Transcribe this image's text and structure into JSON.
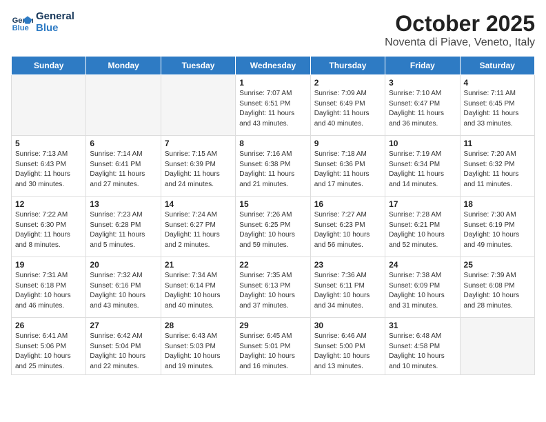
{
  "header": {
    "logo_line1": "General",
    "logo_line2": "Blue",
    "title": "October 2025",
    "subtitle": "Noventa di Piave, Veneto, Italy"
  },
  "weekdays": [
    "Sunday",
    "Monday",
    "Tuesday",
    "Wednesday",
    "Thursday",
    "Friday",
    "Saturday"
  ],
  "weeks": [
    [
      {
        "day": null
      },
      {
        "day": null
      },
      {
        "day": null
      },
      {
        "day": "1",
        "sunrise": "7:07 AM",
        "sunset": "6:51 PM",
        "daylight": "11 hours and 43 minutes."
      },
      {
        "day": "2",
        "sunrise": "7:09 AM",
        "sunset": "6:49 PM",
        "daylight": "11 hours and 40 minutes."
      },
      {
        "day": "3",
        "sunrise": "7:10 AM",
        "sunset": "6:47 PM",
        "daylight": "11 hours and 36 minutes."
      },
      {
        "day": "4",
        "sunrise": "7:11 AM",
        "sunset": "6:45 PM",
        "daylight": "11 hours and 33 minutes."
      }
    ],
    [
      {
        "day": "5",
        "sunrise": "7:13 AM",
        "sunset": "6:43 PM",
        "daylight": "11 hours and 30 minutes."
      },
      {
        "day": "6",
        "sunrise": "7:14 AM",
        "sunset": "6:41 PM",
        "daylight": "11 hours and 27 minutes."
      },
      {
        "day": "7",
        "sunrise": "7:15 AM",
        "sunset": "6:39 PM",
        "daylight": "11 hours and 24 minutes."
      },
      {
        "day": "8",
        "sunrise": "7:16 AM",
        "sunset": "6:38 PM",
        "daylight": "11 hours and 21 minutes."
      },
      {
        "day": "9",
        "sunrise": "7:18 AM",
        "sunset": "6:36 PM",
        "daylight": "11 hours and 17 minutes."
      },
      {
        "day": "10",
        "sunrise": "7:19 AM",
        "sunset": "6:34 PM",
        "daylight": "11 hours and 14 minutes."
      },
      {
        "day": "11",
        "sunrise": "7:20 AM",
        "sunset": "6:32 PM",
        "daylight": "11 hours and 11 minutes."
      }
    ],
    [
      {
        "day": "12",
        "sunrise": "7:22 AM",
        "sunset": "6:30 PM",
        "daylight": "11 hours and 8 minutes."
      },
      {
        "day": "13",
        "sunrise": "7:23 AM",
        "sunset": "6:28 PM",
        "daylight": "11 hours and 5 minutes."
      },
      {
        "day": "14",
        "sunrise": "7:24 AM",
        "sunset": "6:27 PM",
        "daylight": "11 hours and 2 minutes."
      },
      {
        "day": "15",
        "sunrise": "7:26 AM",
        "sunset": "6:25 PM",
        "daylight": "10 hours and 59 minutes."
      },
      {
        "day": "16",
        "sunrise": "7:27 AM",
        "sunset": "6:23 PM",
        "daylight": "10 hours and 56 minutes."
      },
      {
        "day": "17",
        "sunrise": "7:28 AM",
        "sunset": "6:21 PM",
        "daylight": "10 hours and 52 minutes."
      },
      {
        "day": "18",
        "sunrise": "7:30 AM",
        "sunset": "6:19 PM",
        "daylight": "10 hours and 49 minutes."
      }
    ],
    [
      {
        "day": "19",
        "sunrise": "7:31 AM",
        "sunset": "6:18 PM",
        "daylight": "10 hours and 46 minutes."
      },
      {
        "day": "20",
        "sunrise": "7:32 AM",
        "sunset": "6:16 PM",
        "daylight": "10 hours and 43 minutes."
      },
      {
        "day": "21",
        "sunrise": "7:34 AM",
        "sunset": "6:14 PM",
        "daylight": "10 hours and 40 minutes."
      },
      {
        "day": "22",
        "sunrise": "7:35 AM",
        "sunset": "6:13 PM",
        "daylight": "10 hours and 37 minutes."
      },
      {
        "day": "23",
        "sunrise": "7:36 AM",
        "sunset": "6:11 PM",
        "daylight": "10 hours and 34 minutes."
      },
      {
        "day": "24",
        "sunrise": "7:38 AM",
        "sunset": "6:09 PM",
        "daylight": "10 hours and 31 minutes."
      },
      {
        "day": "25",
        "sunrise": "7:39 AM",
        "sunset": "6:08 PM",
        "daylight": "10 hours and 28 minutes."
      }
    ],
    [
      {
        "day": "26",
        "sunrise": "6:41 AM",
        "sunset": "5:06 PM",
        "daylight": "10 hours and 25 minutes."
      },
      {
        "day": "27",
        "sunrise": "6:42 AM",
        "sunset": "5:04 PM",
        "daylight": "10 hours and 22 minutes."
      },
      {
        "day": "28",
        "sunrise": "6:43 AM",
        "sunset": "5:03 PM",
        "daylight": "10 hours and 19 minutes."
      },
      {
        "day": "29",
        "sunrise": "6:45 AM",
        "sunset": "5:01 PM",
        "daylight": "10 hours and 16 minutes."
      },
      {
        "day": "30",
        "sunrise": "6:46 AM",
        "sunset": "5:00 PM",
        "daylight": "10 hours and 13 minutes."
      },
      {
        "day": "31",
        "sunrise": "6:48 AM",
        "sunset": "4:58 PM",
        "daylight": "10 hours and 10 minutes."
      },
      {
        "day": null
      }
    ]
  ],
  "labels": {
    "sunrise": "Sunrise:",
    "sunset": "Sunset:",
    "daylight": "Daylight:"
  }
}
